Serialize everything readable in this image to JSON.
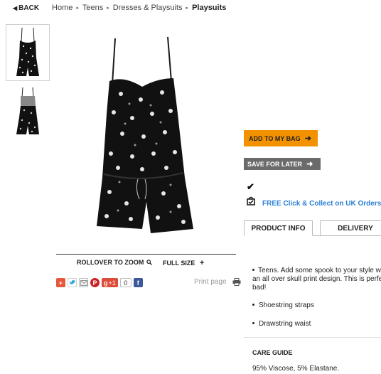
{
  "nav": {
    "back_label": "BACK",
    "breadcrumbs": [
      "Home",
      "Teens",
      "Dresses & Playsuits",
      "Playsuits"
    ]
  },
  "gallery": {
    "zoom_label": "ROLLOVER TO ZOOM",
    "fullsize_label": "FULL SIZE",
    "print_label": "Print page",
    "gplus_label": "+1",
    "gplus_count": "0"
  },
  "actions": {
    "add_to_bag": "ADD TO MY BAG",
    "save_for_later": "SAVE FOR LATER",
    "checkmark": "✔",
    "click_collect": "FREE Click & Collect on UK Orders ov",
    "accent_orange": "#f39200",
    "link_blue": "#2b7fd4"
  },
  "tabs": {
    "product_info": "PRODUCT INFO",
    "delivery": "DELIVERY"
  },
  "info": {
    "description": "Teens. Add some spook to your style wi an all over skull print design. This is perfe bad!",
    "bullets": [
      "Shoestring straps",
      "Drawstring waist"
    ],
    "care_title": "CARE GUIDE",
    "composition": "95% Viscose, 5% Elastane."
  }
}
